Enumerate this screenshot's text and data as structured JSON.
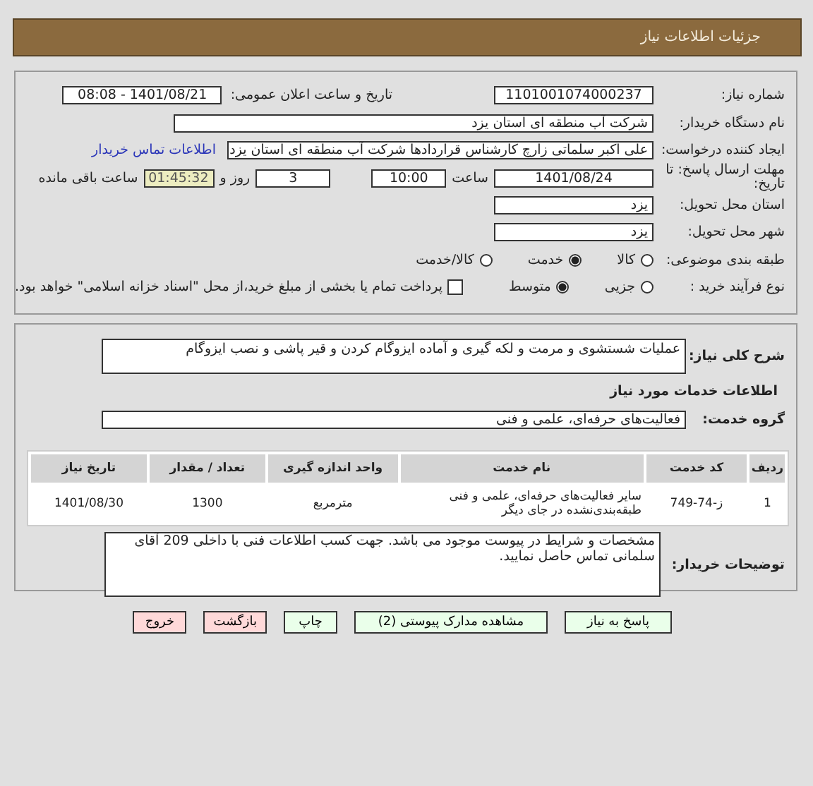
{
  "header": {
    "title": "جزئیات اطلاعات نیاز"
  },
  "need_number": {
    "label": "شماره نیاز:",
    "value": "1101001074000237"
  },
  "announce": {
    "label": "تاریخ و ساعت اعلان عمومی:",
    "value": "1401/08/21 - 08:08"
  },
  "buyer": {
    "label": "نام دستگاه خریدار:",
    "value": "شرکت آب منطقه ای استان یزد"
  },
  "requester": {
    "label": "ایجاد کننده درخواست:",
    "value": "علی اکبر سلماتی زارچ کارشناس قراردادها شرکت آب منطقه ای استان یزد",
    "link": "اطلاعات تماس خریدار"
  },
  "deadline": {
    "label": "مهلت ارسال پاسخ: تا تاریخ:",
    "date": "1401/08/24",
    "time_label": "ساعت",
    "time": "10:00",
    "days": "3",
    "days_label": "روز و",
    "remaining": "01:45:32",
    "remaining_label": "ساعت باقی مانده"
  },
  "province": {
    "label": "استان محل تحویل:",
    "value": "یزد"
  },
  "city": {
    "label": "شهر محل تحویل:",
    "value": "یزد"
  },
  "category": {
    "label": "طبقه بندی موضوعی:",
    "options": [
      {
        "label": "کالا",
        "selected": false
      },
      {
        "label": "خدمت",
        "selected": true
      },
      {
        "label": "کالا/خدمت",
        "selected": false
      }
    ]
  },
  "process": {
    "label": "نوع فرآیند خرید :",
    "options": [
      {
        "label": "جزیی",
        "selected": false
      },
      {
        "label": "متوسط",
        "selected": true
      }
    ],
    "payment": {
      "label": "پرداخت تمام یا بخشی از مبلغ خرید،از محل \"اسناد خزانه اسلامی\" خواهد بود.",
      "checked": false
    }
  },
  "description": {
    "label": "شرح کلی نیاز:",
    "value": "عملیات شستشوی و مرمت و لکه گیری و آماده ایزوگام کردن و قیر پاشی و نصب ایزوگام"
  },
  "services_title": "اطلاعات خدمات مورد نیاز",
  "service_group": {
    "label": "گروه خدمت:",
    "value": "فعالیت‌های حرفه‌ای، علمی و فنی"
  },
  "table": {
    "columns": [
      "ردیف",
      "کد خدمت",
      "نام خدمت",
      "واحد اندازه گیری",
      "تعداد / مقدار",
      "تاریخ نیاز"
    ],
    "rows": [
      [
        "1",
        "ز-74-749",
        "سایر فعالیت‌های حرفه‌ای، علمی و فنی طبقه‌بندی‌نشده در جای دیگر",
        "مترمربع",
        "1300",
        "1401/08/30"
      ]
    ]
  },
  "notes": {
    "label": "توضیحات خریدار:",
    "value": "مشخصات و شرایط در پیوست موجود می باشد. جهت کسب اطلاعات فنی با داخلی 209 آقای سلمانی تماس حاصل نمایید."
  },
  "buttons": [
    {
      "label": "پاسخ به نیاز",
      "kind": "primary"
    },
    {
      "label": "مشاهده مدارک پیوستی (2)",
      "kind": "primary"
    },
    {
      "label": "چاپ",
      "kind": "primary"
    },
    {
      "label": "بازگشت",
      "kind": "danger"
    },
    {
      "label": "خروج",
      "kind": "danger"
    }
  ]
}
